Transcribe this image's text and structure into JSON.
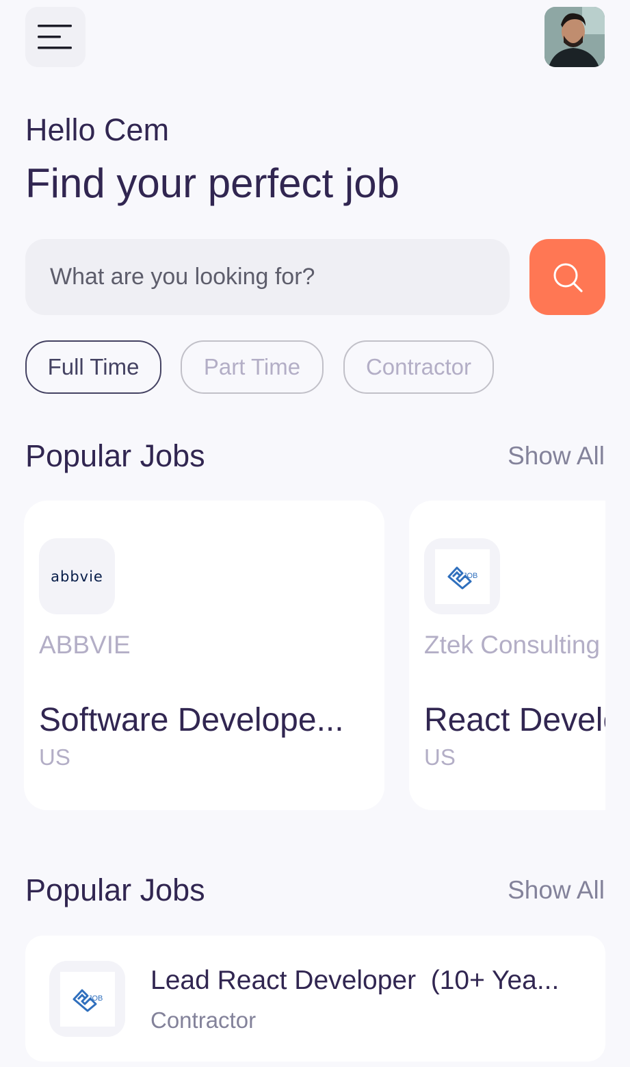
{
  "header": {
    "menu_icon": "menu-icon",
    "avatar_icon": "profile-avatar"
  },
  "greeting": {
    "hello": "Hello Cem",
    "headline": "Find your perfect job"
  },
  "search": {
    "placeholder": "What are you looking for?",
    "value": "",
    "icon": "search-icon"
  },
  "job_types": [
    {
      "label": "Full Time",
      "active": true
    },
    {
      "label": "Part Time",
      "active": false
    },
    {
      "label": "Contractor",
      "active": false
    }
  ],
  "popular": {
    "title": "Popular Jobs",
    "show_all": "Show All",
    "cards": [
      {
        "logo_text": "abbvie",
        "company": "ABBVIE",
        "title": "Software Develope...",
        "location": "US"
      },
      {
        "logo_text": "JOB",
        "company": "Ztek Consulting",
        "title": "React Developer",
        "location": "US"
      }
    ]
  },
  "nearby": {
    "title": "Popular Jobs",
    "show_all": "Show All",
    "items": [
      {
        "logo_text": "JOB",
        "title": "Lead React Developer  (10+ Yea...",
        "type": "Contractor"
      }
    ]
  },
  "colors": {
    "background": "#f8f8fc",
    "primary_text": "#312651",
    "accent": "#ff7754",
    "muted": "#b3aec6",
    "gray": "#83829a"
  }
}
